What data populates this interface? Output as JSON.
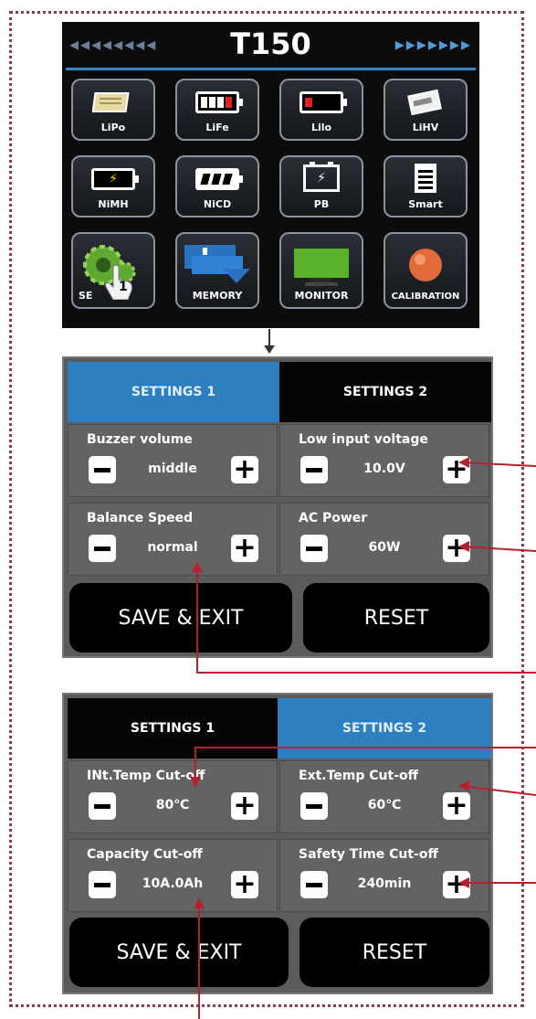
{
  "header": {
    "title": "T150",
    "left_arrows": "◂◂◂◂◂◂◂◂",
    "right_arrows": "▸▸▸▸▸▸▸"
  },
  "menu_tiles": [
    {
      "label": "LiPo",
      "icon": "battery-lipo-icon"
    },
    {
      "label": "LiFe",
      "icon": "battery-life-icon"
    },
    {
      "label": "Lilo",
      "icon": "battery-lilo-icon"
    },
    {
      "label": "LiHV",
      "icon": "battery-lihv-icon"
    },
    {
      "label": "NiMH",
      "icon": "battery-nimh-icon"
    },
    {
      "label": "NiCD",
      "icon": "battery-nicd-icon"
    },
    {
      "label": "PB",
      "icon": "battery-pb-icon"
    },
    {
      "label": "Smart",
      "icon": "battery-smart-icon"
    },
    {
      "label": "SE",
      "icon": "gear-icon"
    },
    {
      "label": "MEMORY",
      "icon": "memory-icon"
    },
    {
      "label": "MONITOR",
      "icon": "monitor-icon"
    },
    {
      "label": "CALIBRATION",
      "icon": "calibration-icon"
    }
  ],
  "touch_hint": "1",
  "settings_panel_1": {
    "tabs": [
      "SETTINGS 1",
      "SETTINGS 2"
    ],
    "active_tab": 0,
    "items": [
      {
        "label": "Buzzer volume",
        "value": "middle"
      },
      {
        "label": "Low input voltage",
        "value": "10.0V"
      },
      {
        "label": "Balance Speed",
        "value": "normal"
      },
      {
        "label": "AC Power",
        "value": "60W"
      }
    ],
    "save_label": "SAVE & EXIT",
    "reset_label": "RESET"
  },
  "settings_panel_2": {
    "tabs": [
      "SETTINGS 1",
      "SETTINGS 2"
    ],
    "active_tab": 1,
    "items": [
      {
        "label": "INt.Temp Cut-off",
        "value": "80℃"
      },
      {
        "label": "Ext.Temp Cut-off",
        "value": "60℃"
      },
      {
        "label": "Capacity Cut-off",
        "value": "10A.0Ah"
      },
      {
        "label": "Safety Time Cut-off",
        "value": "240min"
      }
    ],
    "save_label": "SAVE & EXIT",
    "reset_label": "RESET"
  },
  "colors": {
    "active_tab": "#2d7fc0",
    "panel_bg": "#5b5b5b",
    "annotation": "#b3202f",
    "frame": "#8c3a52"
  }
}
